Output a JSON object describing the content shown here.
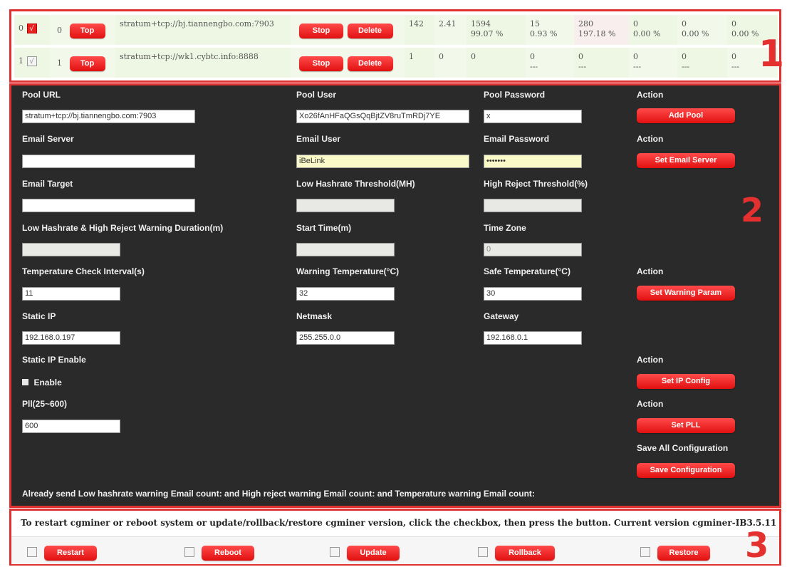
{
  "pools": [
    {
      "index": "0",
      "checked": true,
      "checkmark": "√",
      "priority": "0",
      "top_label": "Top",
      "url": "stratum+tcp://bj.tiannengbo.com:7903",
      "stop_label": "Stop",
      "delete_label": "Delete",
      "getworks": "142",
      "diff": "2.41",
      "accepted": "1594",
      "accepted_pct": "99.07 %",
      "rejected": "15",
      "rejected_pct": "0.93 %",
      "stale": "280",
      "stale_pct": "197.18 %",
      "c1": "0",
      "c1_pct": "0.00 %",
      "c2": "0",
      "c2_pct": "0.00 %",
      "c3": "0",
      "c3_pct": "0.00 %"
    },
    {
      "index": "1",
      "checked": false,
      "checkmark": "√",
      "priority": "1",
      "top_label": "Top",
      "url": "stratum+tcp://wk1.cybtc.info:8888",
      "stop_label": "Stop",
      "delete_label": "Delete",
      "getworks": "1",
      "diff": "0",
      "accepted": "0",
      "accepted_pct": "",
      "rejected": "0",
      "rejected_pct": "---",
      "stale": "0",
      "stale_pct": "---",
      "c1": "0",
      "c1_pct": "---",
      "c2": "0",
      "c2_pct": "---",
      "c3": "0",
      "c3_pct": "---"
    }
  ],
  "annotations": {
    "one": "1",
    "two": "2",
    "three": "3"
  },
  "form": {
    "pool_url_label": "Pool URL",
    "pool_user_label": "Pool User",
    "pool_password_label": "Pool Password",
    "action_label": "Action",
    "pool_url_value": "stratum+tcp://bj.tiannengbo.com:7903",
    "pool_user_value": "Xo26fAnHFaQGsQqBjtZV8ruTmRDj7YE",
    "pool_password_value": "x",
    "add_pool": "Add Pool",
    "email_server_label": "Email Server",
    "email_user_label": "Email User",
    "email_password_label": "Email Password",
    "email_server_value": "",
    "email_user_value": "iBeLink",
    "email_password_value": "•••••••",
    "set_email_server": "Set Email Server",
    "email_target_label": "Email Target",
    "low_hashrate_label": "Low Hashrate Threshold(MH)",
    "high_reject_label": "High Reject Threshold(%)",
    "warning_duration_label": "Low Hashrate & High Reject Warning Duration(m)",
    "start_time_label": "Start Time(m)",
    "time_zone_label": "Time Zone",
    "time_zone_value": "0",
    "temp_interval_label": "Temperature Check Interval(s)",
    "warning_temp_label": "Warning Temperature(°C)",
    "safe_temp_label": "Safe Temperature(°C)",
    "temp_interval_value": "11",
    "warning_temp_value": "32",
    "safe_temp_value": "30",
    "set_warning_param": "Set Warning Param",
    "static_ip_label": "Static IP",
    "netmask_label": "Netmask",
    "gateway_label": "Gateway",
    "static_ip_value": "192.168.0.197",
    "netmask_value": "255.255.0.0",
    "gateway_value": "192.168.0.1",
    "static_ip_enable_label": "Static IP Enable",
    "enable_label": "Enable",
    "set_ip_config": "Set IP Config",
    "pll_label": "Pll(25~600)",
    "pll_value": "600",
    "set_pll": "Set PLL",
    "save_all_label": "Save All Configuration",
    "save_configuration": "Save Configuration",
    "email_count_line": "Already send Low hashrate warning Email count:   and High reject warning Email count:   and Temperature warning Email count:"
  },
  "system": {
    "message": "To restart cgminer or reboot system or update/rollback/restore cgminer version, click the checkbox, then press the button. Current version cgminer-IB3.5.11",
    "restart": "Restart",
    "reboot": "Reboot",
    "update": "Update",
    "rollback": "Rollback",
    "restore": "Restore"
  },
  "colors": {
    "accent_red": "#e82020",
    "form_bg": "#2a2a2a",
    "highlight_border": "#e03030"
  },
  "icons": [
    "checkbox-checked-icon",
    "checkbox-icon"
  ]
}
